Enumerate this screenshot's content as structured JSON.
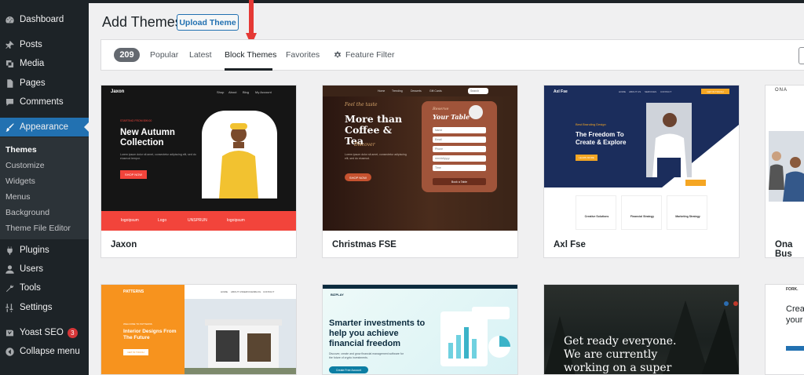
{
  "sidebar": {
    "items": [
      {
        "label": "Dashboard",
        "icon": "dashboard-icon"
      },
      {
        "label": "Posts",
        "icon": "pin-icon"
      },
      {
        "label": "Media",
        "icon": "media-icon"
      },
      {
        "label": "Pages",
        "icon": "page-icon"
      },
      {
        "label": "Comments",
        "icon": "comment-icon"
      },
      {
        "label": "Appearance",
        "icon": "brush-icon"
      },
      {
        "label": "Plugins",
        "icon": "plug-icon"
      },
      {
        "label": "Users",
        "icon": "user-icon"
      },
      {
        "label": "Tools",
        "icon": "wrench-icon"
      },
      {
        "label": "Settings",
        "icon": "sliders-icon"
      },
      {
        "label": "Yoast SEO",
        "icon": "yoast-icon",
        "badge": "3"
      },
      {
        "label": "Collapse menu",
        "icon": "collapse-icon"
      }
    ],
    "submenu": [
      "Themes",
      "Customize",
      "Widgets",
      "Menus",
      "Background",
      "Theme File Editor"
    ]
  },
  "header": {
    "title": "Add Themes",
    "upload_label": "Upload Theme"
  },
  "filter": {
    "count": "209",
    "tabs": [
      "Popular",
      "Latest",
      "Block Themes",
      "Favorites"
    ],
    "feature_filter": "Feature Filter"
  },
  "themes": [
    {
      "name": "Jaxon",
      "brand": "Jaxon",
      "nav": [
        "Shop",
        "About",
        "Blog",
        "My Account"
      ],
      "tagline": "STARTING FROM $99.00",
      "headline": "New Autumn Collection",
      "body": "Lorem ipsum dolor sit amet, consectetur adipiscing elit, sed do eiusmod tempor.",
      "cta": "SHOP NOW",
      "logos": [
        "logoipsum",
        "Logo",
        "UNSPRUN",
        "logoipsum"
      ]
    },
    {
      "name": "Christmas FSE",
      "nav": [
        "Home",
        "Trending",
        "Desserts",
        "Gift Cards",
        "Search"
      ],
      "kicker": "Feel the taste",
      "headline": "More than Coffee & Tea",
      "accent": "Discover",
      "body": "Lorem ipsum dolor sit amet, consectetur adipiscing elit, sed do eiusmod.",
      "cta": "SHOP NOW",
      "form_kicker": "Reserve",
      "form_title": "Your Table",
      "fields": [
        "Name",
        "Email",
        "Phone",
        "mm/dd/yyyy",
        "Time"
      ],
      "form_button": "Book a Table"
    },
    {
      "name": "Axl Fse",
      "brand": "Axl Fse",
      "nav": [
        "HOME",
        "ABOUT US",
        "SERVICES",
        "CONTACT",
        "GET IN TOUCH"
      ],
      "kicker": "Best Branding Design",
      "headline": "The Freedom To Create & Explore",
      "cta": "LEARN MORE",
      "features": [
        "Creative Solutions",
        "Financial Strategy",
        "Marketing Strategy"
      ]
    },
    {
      "name": "Ona Bus",
      "brand": "ONA"
    },
    {
      "name": "",
      "brand": "PATTERNS",
      "nav": [
        "HOME",
        "ABOUT US",
        "SERVICES",
        "BLOG",
        "CONTACT"
      ],
      "kicker": "WELCOME TO PATTERNS",
      "headline": "Interior Designs From The Future",
      "cta": "GET IN TOUCH"
    },
    {
      "name": "",
      "brand": "BIZPLAY",
      "headline": "Smarter investments to help you achieve financial freedom",
      "body": "Discover, create and grow financial management software for the future of crypto investments.",
      "cta": "Create Free Account"
    },
    {
      "name": "",
      "headline": "Get ready everyone. We are currently working on a super"
    },
    {
      "name": "",
      "brand": "FORK.",
      "headline": "Crea your"
    }
  ],
  "colors": {
    "sidebar": "#1d2327",
    "accent": "#2271b1",
    "arrow": "#e53935",
    "jaxon_red": "#f2443b",
    "axl_navy": "#1b2d5c",
    "axl_orange": "#f5a623",
    "patterns_orange": "#f7931e"
  }
}
